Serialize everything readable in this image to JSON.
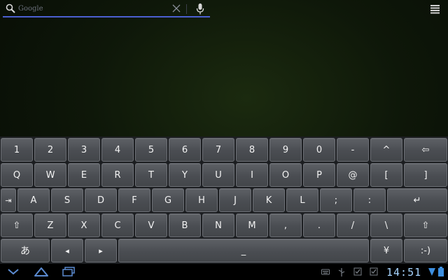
{
  "search": {
    "placeholder": "Google",
    "value": ""
  },
  "keyboard": {
    "rows": [
      [
        "1",
        "2",
        "3",
        "4",
        "5",
        "6",
        "7",
        "8",
        "9",
        "0",
        "-",
        "^",
        "⇦"
      ],
      [
        "Q",
        "W",
        "E",
        "R",
        "T",
        "Y",
        "U",
        "I",
        "O",
        "P",
        "@",
        "[",
        "]"
      ],
      [
        "⇥",
        "A",
        "S",
        "D",
        "F",
        "G",
        "H",
        "J",
        "K",
        "L",
        ";",
        ":",
        "↵"
      ],
      [
        "⇧",
        "Z",
        "X",
        "C",
        "V",
        "B",
        "N",
        "M",
        ",",
        ".",
        "/",
        "\\",
        "⇧"
      ],
      [
        "あ",
        "◂",
        "▸",
        "_",
        "¥",
        ":-)"
      ]
    ]
  },
  "status": {
    "clock": "14:51"
  },
  "colors": {
    "search_underline": "#4b5fd1",
    "clock": "#a7d5ff",
    "key_face": "#4f5257",
    "keyboard_bg": "#1c1e21"
  },
  "icons": {
    "search": "search-icon",
    "clear": "close-icon",
    "mic": "microphone-icon",
    "menu": "menu-icon",
    "back": "back-icon",
    "home": "home-icon",
    "recents": "recent-apps-icon"
  }
}
